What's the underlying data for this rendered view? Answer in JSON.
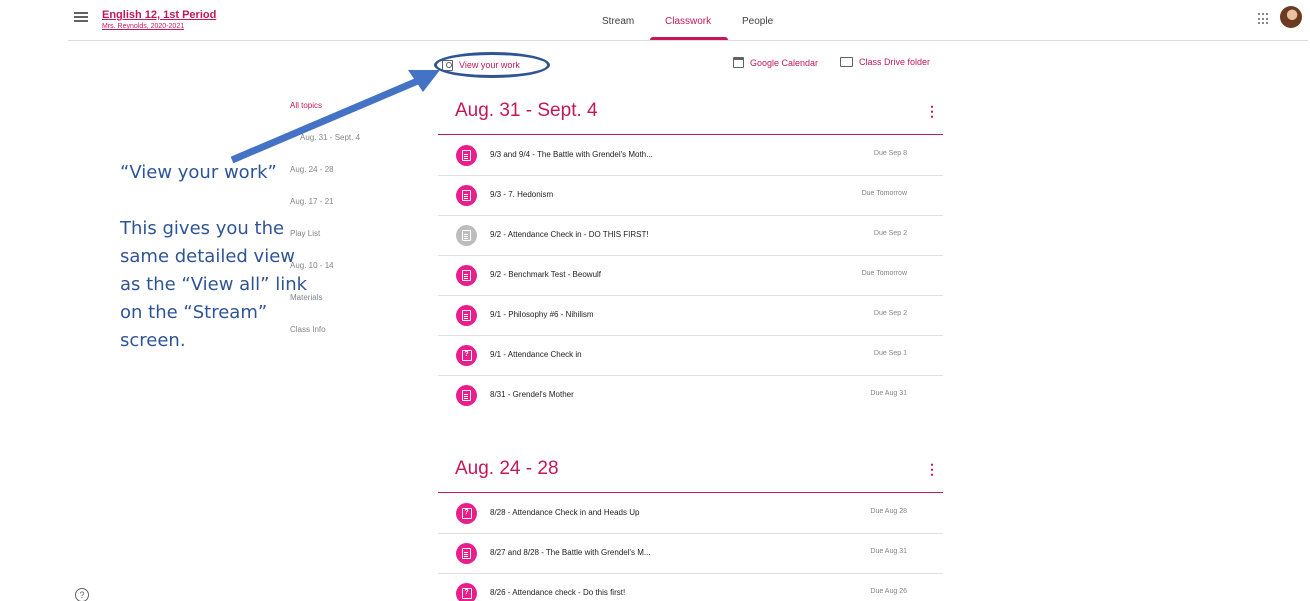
{
  "header": {
    "class_title": "English 12, 1st Period",
    "class_subtitle": "Mrs. Reynolds, 2020-2021",
    "tabs": [
      {
        "label": "Stream"
      },
      {
        "label": "Classwork"
      },
      {
        "label": "People"
      }
    ],
    "active_tab": "Classwork"
  },
  "toolbar": {
    "view_work": "View your work",
    "calendar": "Google Calendar",
    "drive": "Class Drive folder"
  },
  "annotation": {
    "heading": "“View your work”",
    "body_lines": [
      "This gives you the",
      "same detailed view",
      "as the “View all” link",
      "on the “Stream”",
      "screen."
    ]
  },
  "topics": [
    {
      "label": "All topics"
    },
    {
      "label": "Aug. 31 - Sept. 4"
    },
    {
      "label": "Aug. 24 - 28"
    },
    {
      "label": "Aug. 17 - 21"
    },
    {
      "label": "Play List"
    },
    {
      "label": "Aug. 10 - 14"
    },
    {
      "label": "Materials"
    },
    {
      "label": "Class Info"
    }
  ],
  "sections": [
    {
      "title": "Aug. 31 - Sept. 4",
      "items": [
        {
          "title": "9/3 and 9/4 - The Battle with Grendel's Moth...",
          "due": "Due Sep 8",
          "icon": "assignment-icon",
          "color": "#e91e8c"
        },
        {
          "title": "9/3 - 7. Hedonism",
          "due": "Due Tomorrow",
          "icon": "assignment-icon",
          "color": "#e91e8c"
        },
        {
          "title": "9/2 - Attendance Check in - DO THIS FIRST!",
          "due": "Due Sep 2",
          "icon": "assignment-icon",
          "color": "#bdbdbd"
        },
        {
          "title": "9/2 - Benchmark Test - Beowulf",
          "due": "Due Tomorrow",
          "icon": "assignment-icon",
          "color": "#e91e8c"
        },
        {
          "title": "9/1 - Philosophy #6 - Nihilism",
          "due": "Due Sep 2",
          "icon": "assignment-icon",
          "color": "#e91e8c"
        },
        {
          "title": "9/1 - Attendance Check in",
          "due": "Due Sep 1",
          "icon": "question-icon",
          "color": "#e91e8c"
        },
        {
          "title": "8/31 - Grendel's Mother",
          "due": "Due Aug 31",
          "icon": "assignment-icon",
          "color": "#e91e8c"
        }
      ]
    },
    {
      "title": "Aug. 24 - 28",
      "items": [
        {
          "title": "8/28 - Attendance Check in and Heads Up",
          "due": "Due Aug 28",
          "icon": "question-icon",
          "color": "#e91e8c"
        },
        {
          "title": "8/27 and 8/28 - The Battle with Grendel's M...",
          "due": "Due Aug 31",
          "icon": "assignment-icon",
          "color": "#e91e8c"
        },
        {
          "title": "8/26 - Attendance check - Do this first!",
          "due": "Due Aug 26",
          "icon": "question-icon",
          "color": "#e91e8c"
        }
      ]
    }
  ],
  "colors": {
    "accent": "#c2185b",
    "annotation": "#2f5496"
  }
}
